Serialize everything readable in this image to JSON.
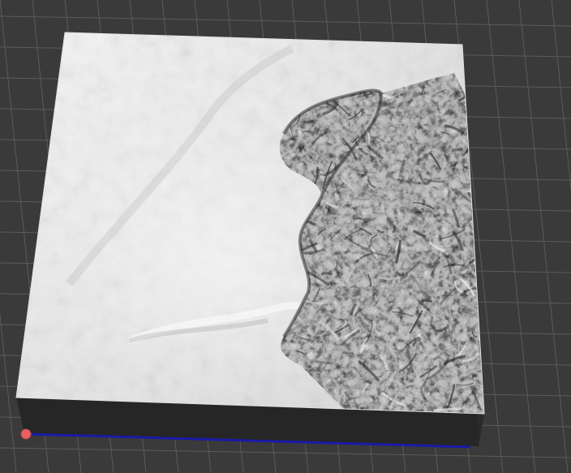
{
  "viewport": {
    "background_color": "#3a3a3a",
    "grid_color": "#5b5b5b"
  },
  "terrain": {
    "surface_color": "#d9d9d9",
    "side_color": "#2a2a2a",
    "shadow_color": "#101010"
  },
  "axis": {
    "x_axis_color": "#1010a0",
    "origin_marker_color": "#e85a5a"
  }
}
